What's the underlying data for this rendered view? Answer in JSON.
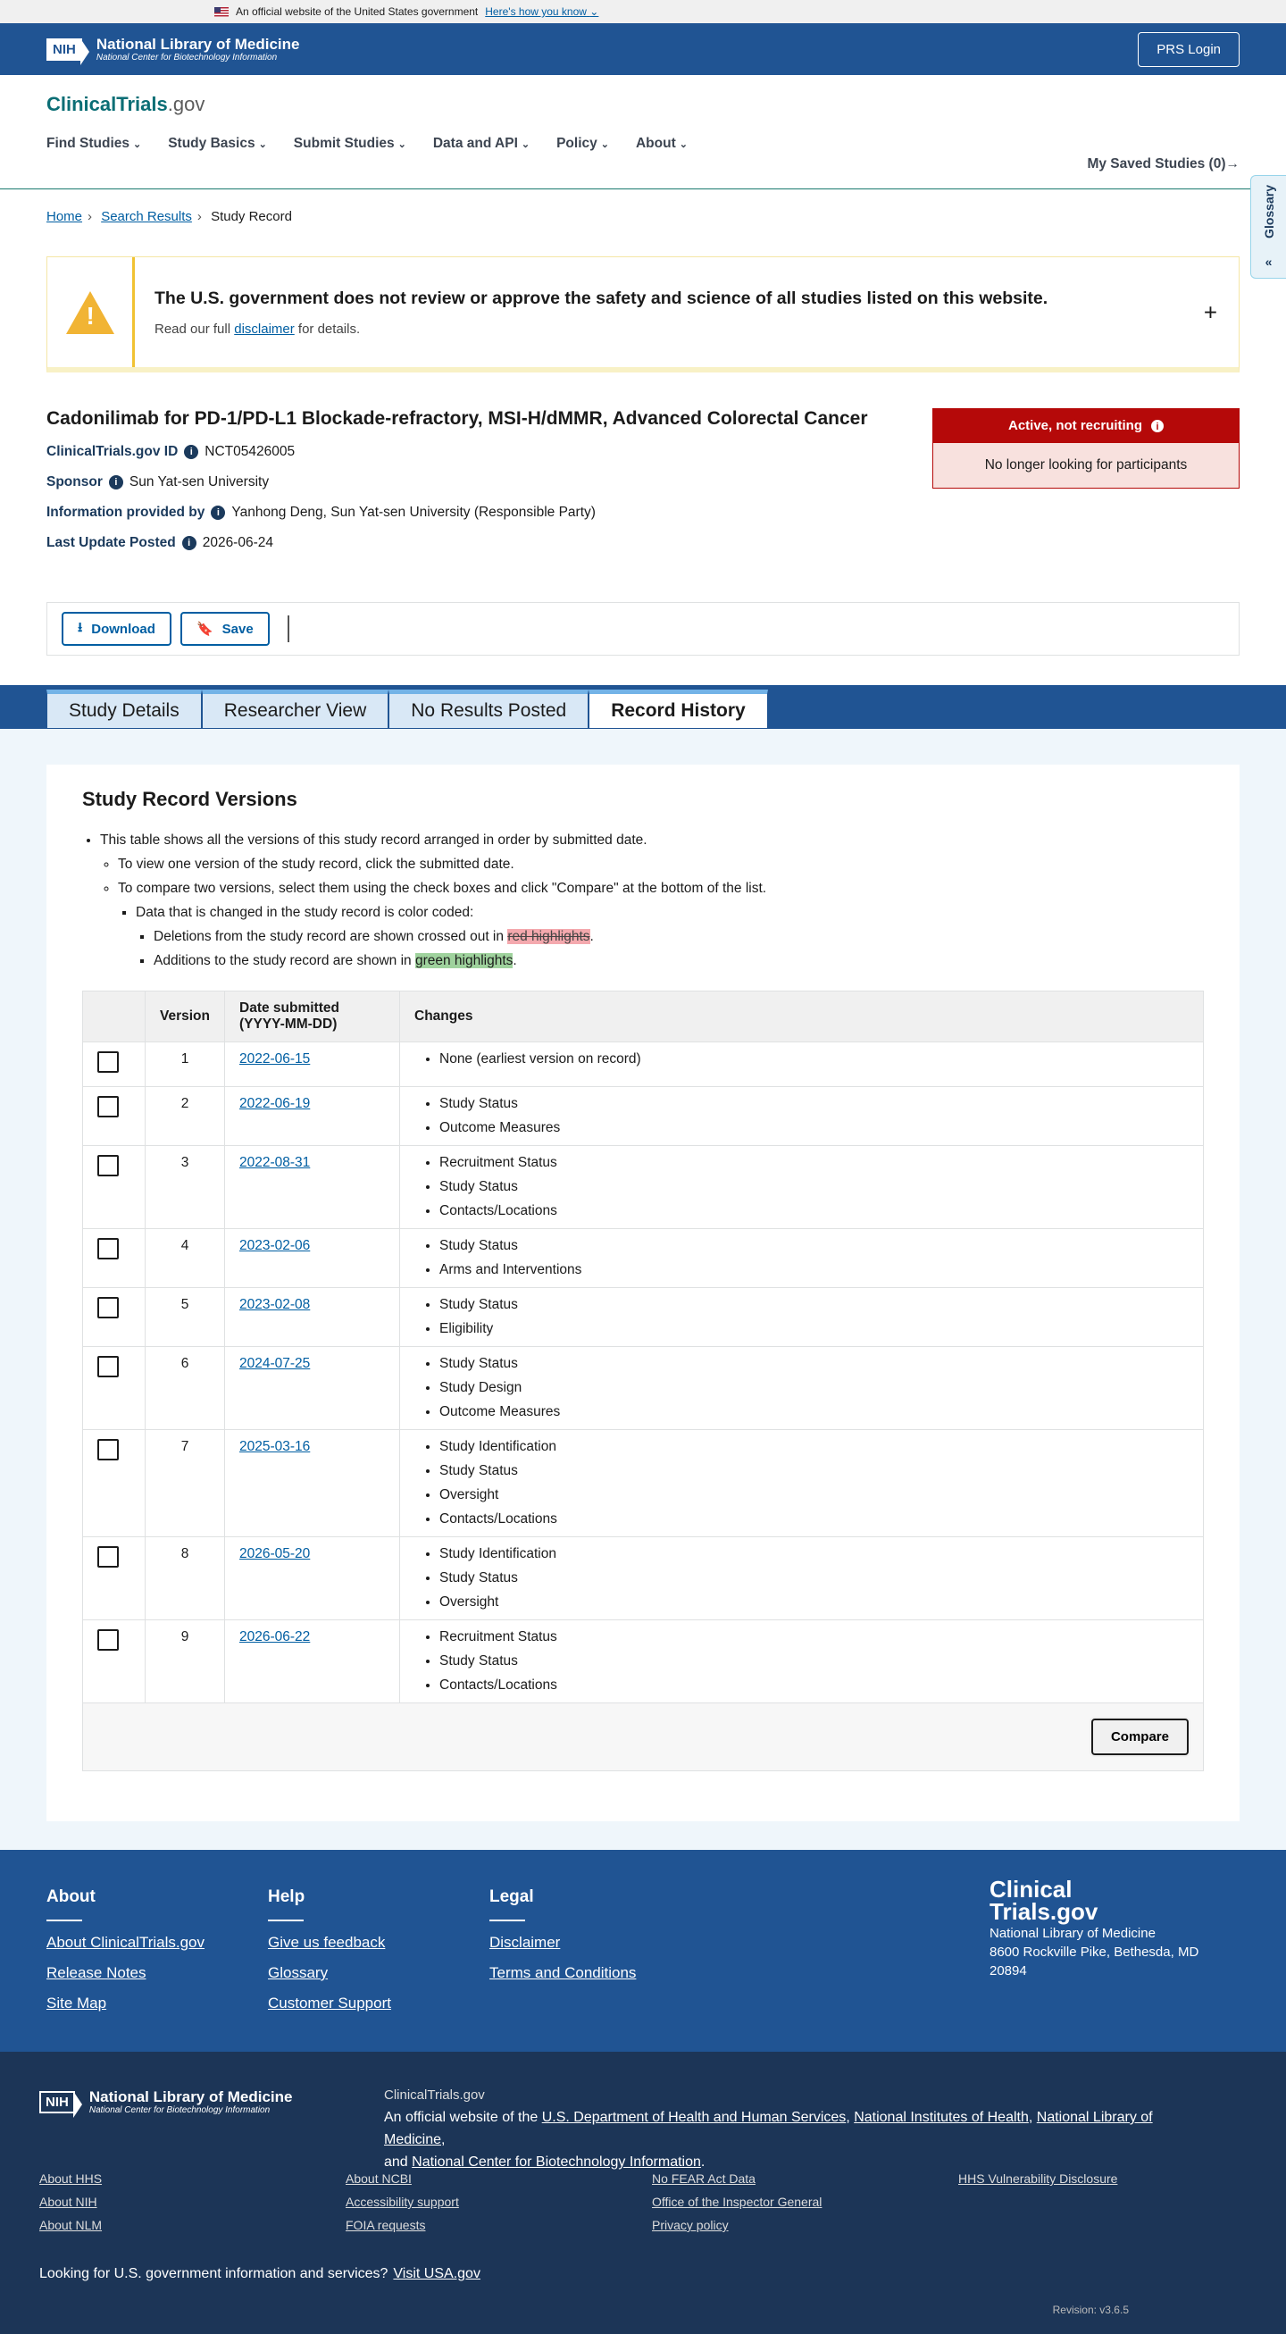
{
  "gov_banner": {
    "text": "An official website of the United States government",
    "link": "Here's how you know"
  },
  "nih_header": {
    "line1": "National Library of Medicine",
    "line2": "National Center for Biotechnology Information",
    "prs_login": "PRS Login"
  },
  "ct": {
    "logo_main": "ClinicalTrials",
    "logo_suffix": ".gov",
    "nav": [
      "Find Studies",
      "Study Basics",
      "Submit Studies",
      "Data and API",
      "Policy",
      "About"
    ],
    "saved": "My Saved Studies (0)"
  },
  "glossary_tab": "Glossary",
  "breadcrumb": [
    "Home",
    "Search Results",
    "Study Record"
  ],
  "alert": {
    "title": "The U.S. government does not review or approve the safety and science of all studies listed on this website.",
    "pre": "Read our full",
    "link": "disclaimer",
    "post": "for details."
  },
  "study": {
    "title": "Cadonilimab for PD-1/PD-L1 Blockade-refractory, MSI-H/dMMR, Advanced Colorectal Cancer",
    "id_label": "ClinicalTrials.gov ID",
    "id_value": "NCT05426005",
    "sponsor_label": "Sponsor",
    "sponsor_value": "Sun Yat-sen University",
    "info_label": "Information provided by",
    "info_value": "Yanhong Deng, Sun Yat-sen University (Responsible Party)",
    "update_label": "Last Update Posted",
    "update_value": "2026-06-24",
    "status_title": "Active, not recruiting",
    "status_sub": "No longer looking for participants"
  },
  "actions": {
    "download": "Download",
    "save": "Save"
  },
  "tabs": [
    "Study Details",
    "Researcher View",
    "No Results Posted",
    "Record History"
  ],
  "versions": {
    "heading": "Study Record Versions",
    "b1": "This table shows all the versions of this study record arranged in order by submitted date.",
    "b2": "To view one version of the study record, click the submitted date.",
    "b3": "To compare two versions, select them using the check boxes and click \"Compare\" at the bottom of the list.",
    "b4": "Data that is changed in the study record is color coded:",
    "b5_pre": "Deletions from the study record are shown crossed out in",
    "b5_hl": "red highlights",
    "b6_pre": "Additions to the study record are shown in",
    "b6_hl": "green highlights",
    "col_version": "Version",
    "col_date1": "Date submitted",
    "col_date2": "(YYYY-MM-DD)",
    "col_changes": "Changes",
    "rows": [
      {
        "v": "1",
        "date": "2022-06-15",
        "changes": [
          "None (earliest version on record)"
        ]
      },
      {
        "v": "2",
        "date": "2022-06-19",
        "changes": [
          "Study Status",
          "Outcome Measures"
        ]
      },
      {
        "v": "3",
        "date": "2022-08-31",
        "changes": [
          "Recruitment Status",
          "Study Status",
          "Contacts/Locations"
        ]
      },
      {
        "v": "4",
        "date": "2023-02-06",
        "changes": [
          "Study Status",
          "Arms and Interventions"
        ]
      },
      {
        "v": "5",
        "date": "2023-02-08",
        "changes": [
          "Study Status",
          "Eligibility"
        ]
      },
      {
        "v": "6",
        "date": "2024-07-25",
        "changes": [
          "Study Status",
          "Study Design",
          "Outcome Measures"
        ]
      },
      {
        "v": "7",
        "date": "2025-03-16",
        "changes": [
          "Study Identification",
          "Study Status",
          "Oversight",
          "Contacts/Locations"
        ]
      },
      {
        "v": "8",
        "date": "2026-05-20",
        "changes": [
          "Study Identification",
          "Study Status",
          "Oversight"
        ]
      },
      {
        "v": "9",
        "date": "2026-06-22",
        "changes": [
          "Recruitment Status",
          "Study Status",
          "Contacts/Locations"
        ]
      }
    ],
    "compare": "Compare"
  },
  "footer": {
    "about_h": "About",
    "about_links": [
      "About ClinicalTrials.gov",
      "Release Notes",
      "Site Map"
    ],
    "help_h": "Help",
    "help_links": [
      "Give us feedback",
      "Glossary",
      "Customer Support"
    ],
    "legal_h": "Legal",
    "legal_links": [
      "Disclaimer",
      "Terms and Conditions"
    ],
    "logo_l1": "Clinical",
    "logo_l2": "Trials.gov",
    "addr1": "National Library of Medicine",
    "addr2": "8600 Rockville Pike, Bethesda, MD",
    "addr3": "20894"
  },
  "footer2": {
    "site": "ClinicalTrials.gov",
    "official_pre": "An official website of the",
    "hhs": "U.S. Department of Health and Human Services",
    "nih": "National Institutes of Health",
    "nlm": "National Library of Medicine",
    "and": "and",
    "ncbi": "National Center for Biotechnology Information",
    "links": [
      "About HHS",
      "About NCBI",
      "No FEAR Act Data",
      "HHS Vulnerability Disclosure",
      "About NIH",
      "Accessibility support",
      "Office of the Inspector General",
      "",
      "About NLM",
      "FOIA requests",
      "Privacy policy",
      ""
    ],
    "usa_pre": "Looking for U.S. government information and services?",
    "usa_link": "Visit USA.gov",
    "revision": "Revision: v3.6.5"
  }
}
